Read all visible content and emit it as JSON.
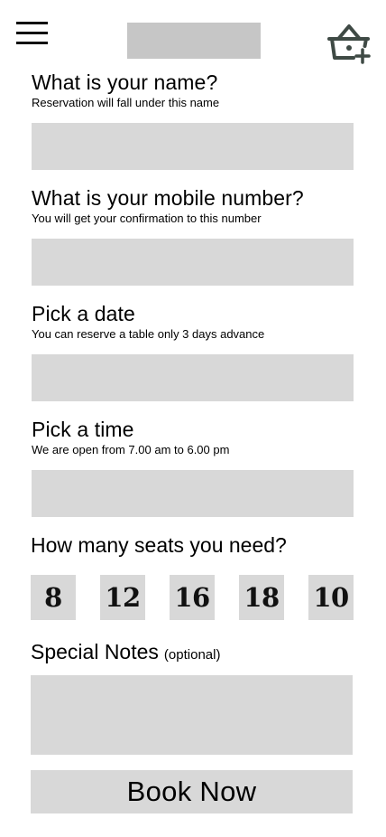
{
  "header": {
    "menu_icon": "hamburger-menu-icon",
    "cart_icon": "basket-add-icon",
    "icon_color": "#3f4a45",
    "placeholder_color": "#c6c6c6"
  },
  "form": {
    "name": {
      "title": "What is your name?",
      "subtitle": "Reservation will fall under this name",
      "value": ""
    },
    "mobile": {
      "title": "What is your mobile number?",
      "subtitle": "You will get your confirmation to this number",
      "value": ""
    },
    "date": {
      "title": "Pick a date",
      "subtitle": "You can reserve a table only 3 days advance",
      "value": ""
    },
    "time": {
      "title": "Pick a time",
      "subtitle": "We are open from 7.00 am to 6.00 pm",
      "value": ""
    },
    "seats": {
      "title": "How many seats you need?",
      "options": [
        "8",
        "12",
        "16",
        "18",
        "10"
      ]
    },
    "notes": {
      "title": "Special Notes",
      "optional": "(optional)",
      "value": ""
    },
    "submit_label": "Book Now"
  },
  "colors": {
    "field_bg": "#d8d8d8",
    "text": "#000000"
  }
}
